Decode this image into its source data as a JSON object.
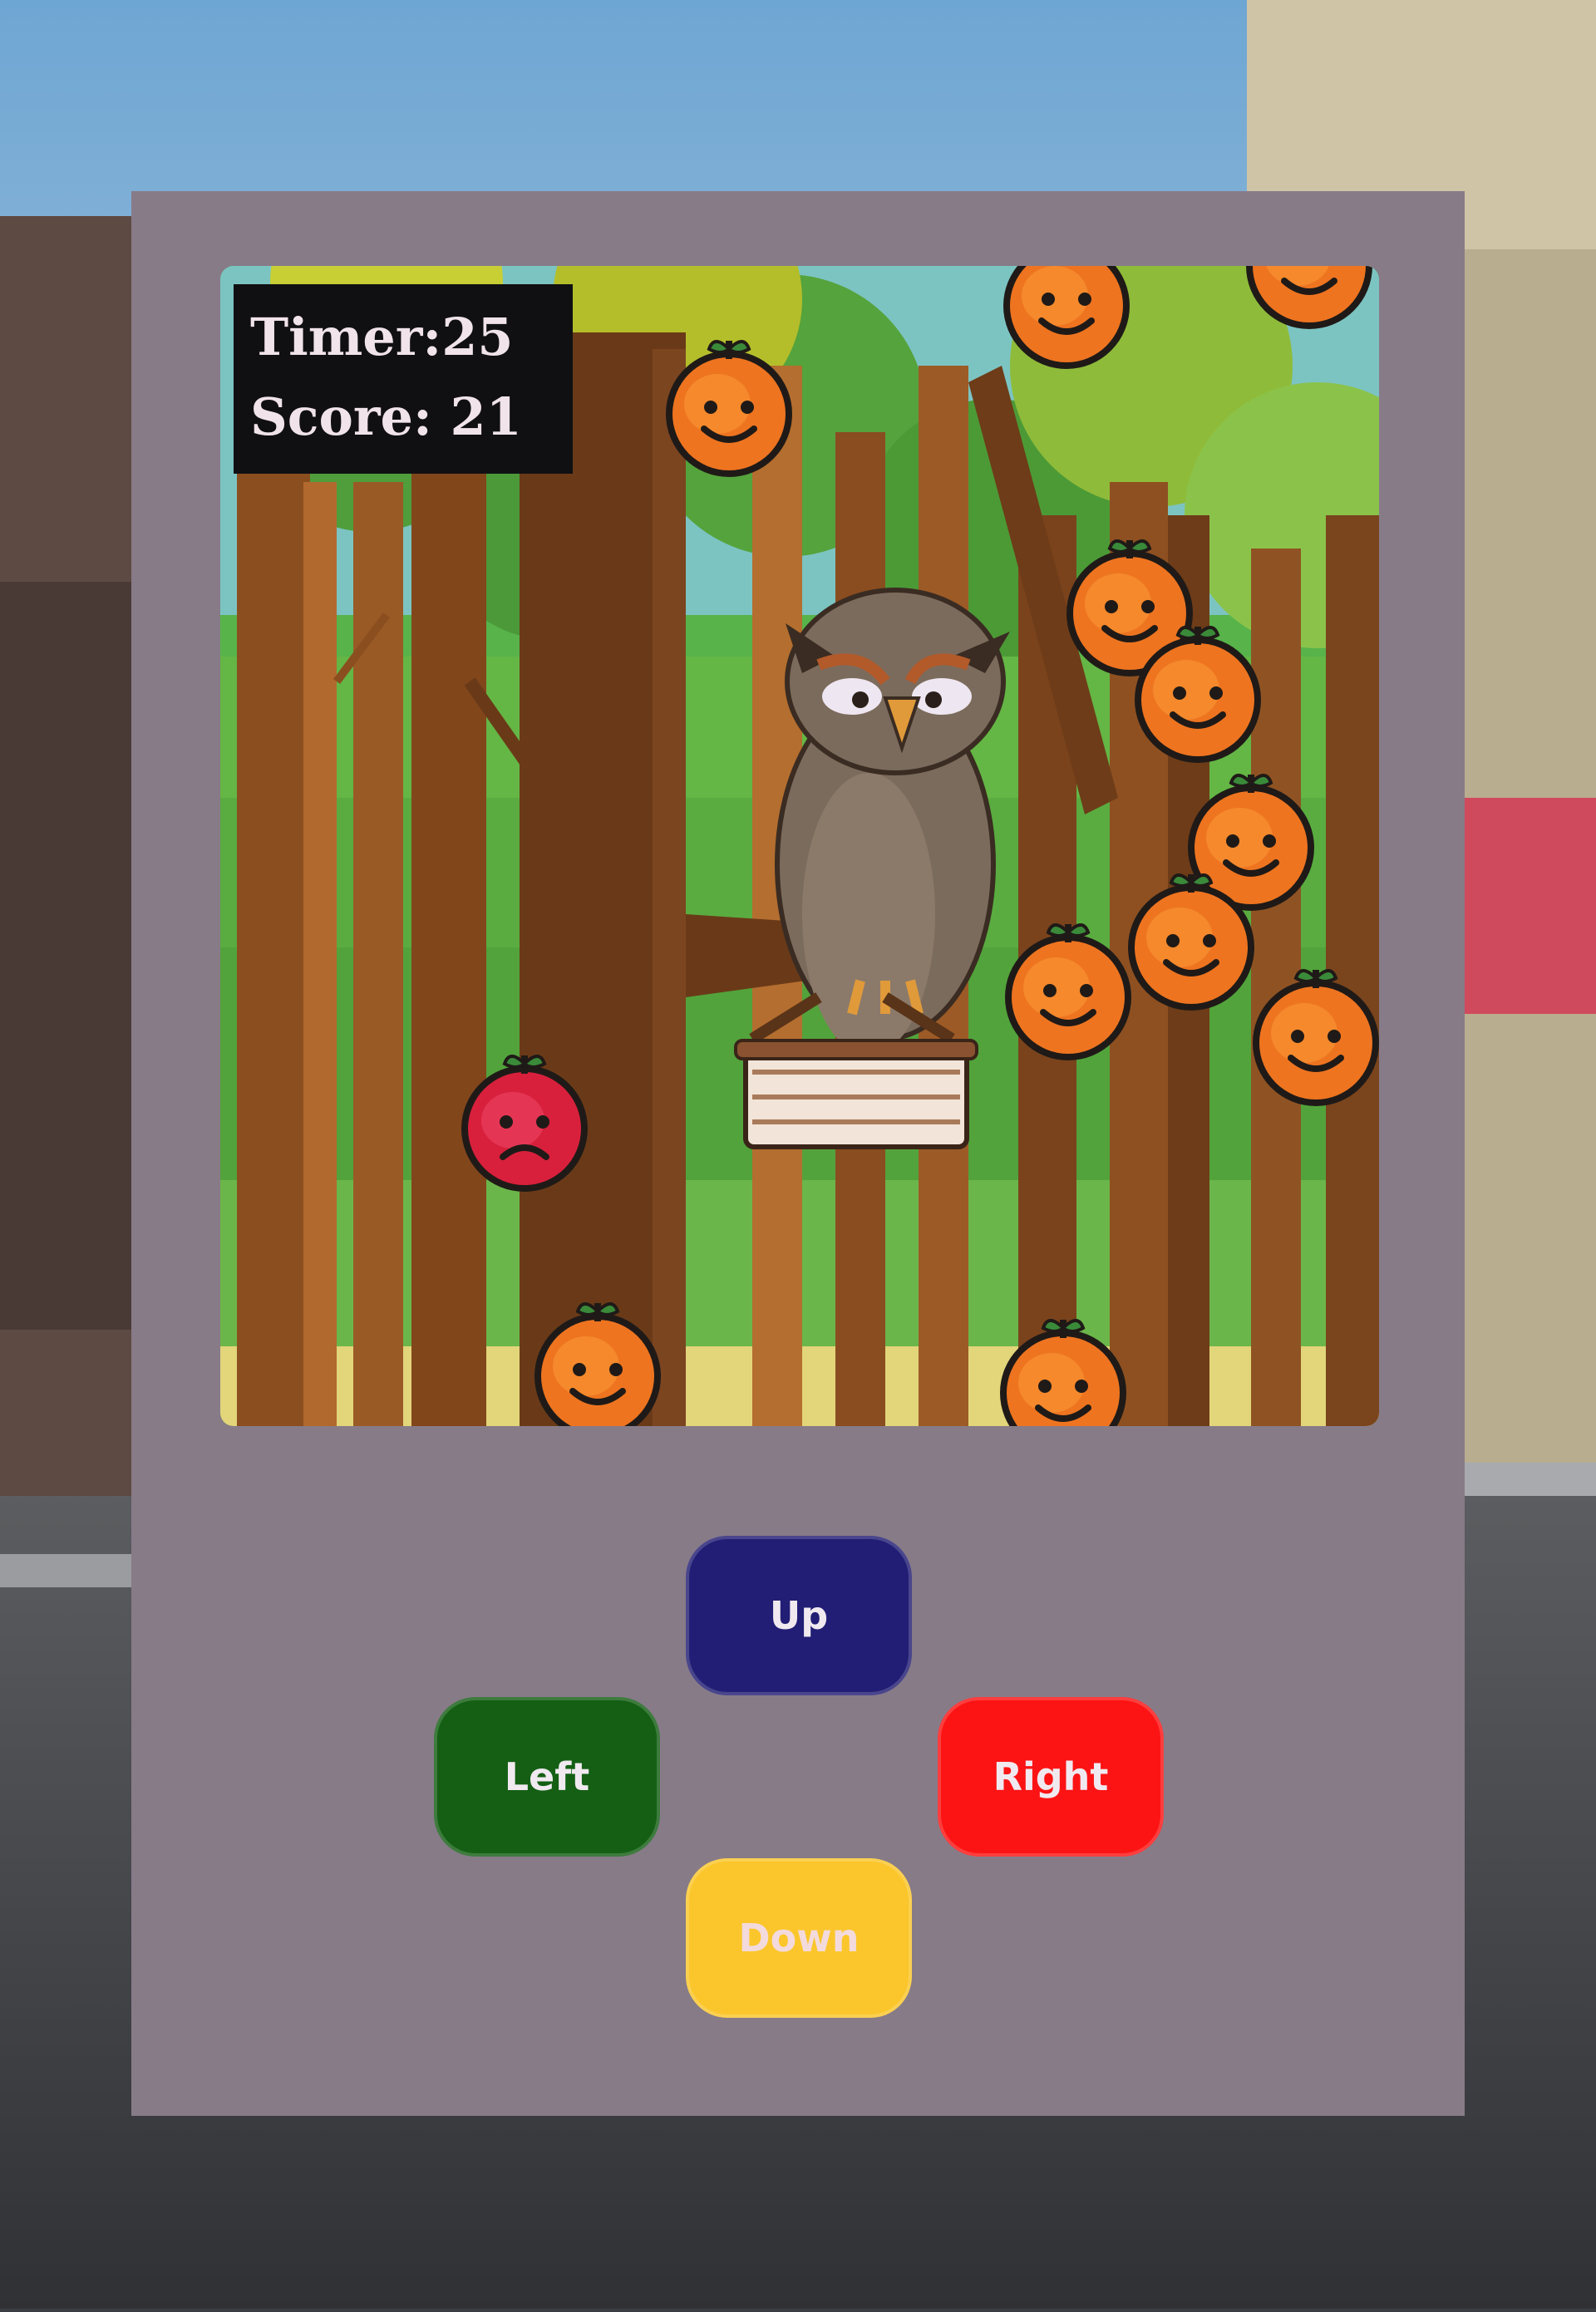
{
  "hud": {
    "timer_text": "Timer:25",
    "score_text": "Score: 21"
  },
  "controls": {
    "up_label": "Up",
    "left_label": "Left",
    "right_label": "Right",
    "down_label": "Down"
  },
  "colors": {
    "panel": "#877b88",
    "up_button": "#221e75",
    "left_button": "#145f14",
    "right_button": "#fc1414",
    "down_button": "#fbc62b",
    "hud_background": "#101013"
  },
  "sprites": {
    "player": "owl-on-branch",
    "catcher": "basket",
    "good_item": "smiling-orange",
    "bad_item": "sad-red-apple"
  }
}
